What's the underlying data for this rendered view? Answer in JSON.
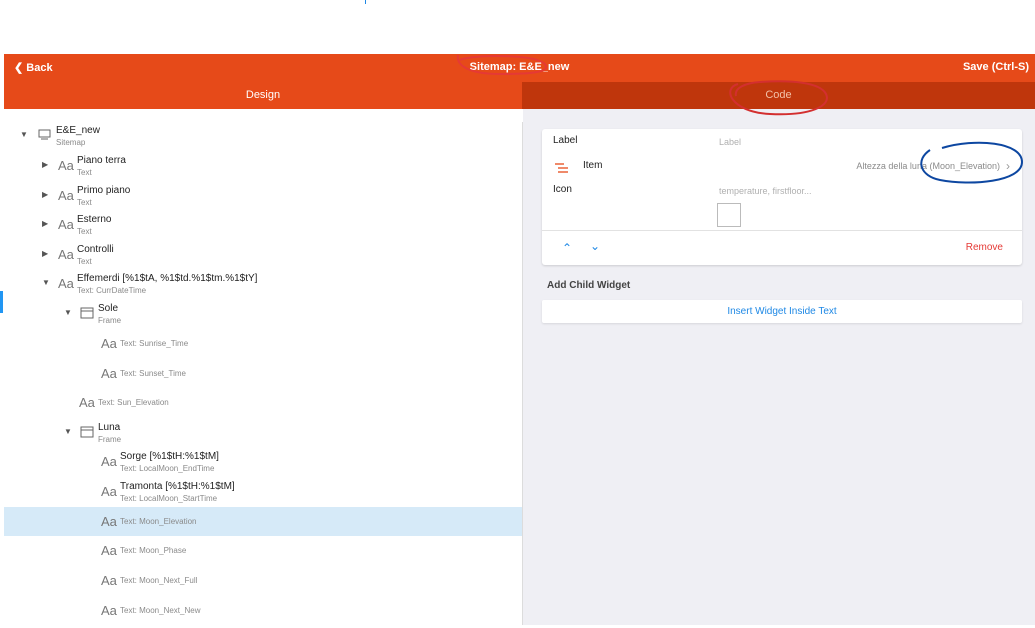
{
  "header": {
    "back_label": "Back",
    "title": "Sitemap: E&E_new",
    "save_label": "Save (Ctrl-S)"
  },
  "tabs": [
    {
      "label": "Design",
      "active": true
    },
    {
      "label": "Code",
      "active": false
    }
  ],
  "tree": {
    "root": {
      "name": "E&E_new",
      "type": "Sitemap"
    },
    "items": [
      {
        "name": "Piano terra",
        "sub": "Text"
      },
      {
        "name": "Primo piano",
        "sub": "Text"
      },
      {
        "name": "Esterno",
        "sub": "Text"
      },
      {
        "name": "Controlli",
        "sub": "Text"
      },
      {
        "name": "Effemerdi [%1$tA, %1$td.%1$tm.%1$tY]",
        "sub": "Text: CurrDateTime"
      },
      {
        "name": "Sole",
        "sub": "Frame"
      },
      {
        "name": "Text: Sunrise_Time"
      },
      {
        "name": "Text: Sunset_Time"
      },
      {
        "name": "Text: Sun_Elevation"
      },
      {
        "name": "Luna",
        "sub": "Frame"
      },
      {
        "name": "Sorge [%1$tH:%1$tM]",
        "sub": "Text: LocalMoon_EndTime"
      },
      {
        "name": "Tramonta [%1$tH:%1$tM]",
        "sub": "Text: LocalMoon_StartTime"
      },
      {
        "name": "Text: Moon_Elevation"
      },
      {
        "name": "Text: Moon_Phase"
      },
      {
        "name": "Text: Moon_Next_Full"
      },
      {
        "name": "Text: Moon_Next_New"
      }
    ]
  },
  "details": {
    "label_caption": "Label",
    "label_placeholder": "Label",
    "item_caption": "Item",
    "item_value": "Altezza della luna (Moon_Elevation)",
    "icon_caption": "Icon",
    "icon_placeholder": "temperature, firstfloor...",
    "remove_label": "Remove"
  },
  "child": {
    "section_title": "Add Child Widget",
    "insert_label": "Insert Widget Inside Text"
  },
  "colors": {
    "accent": "#e64a19",
    "accent_dark": "#bf360c",
    "link": "#1e88e5",
    "danger": "#e53935",
    "selected_row": "#d6eaf8"
  }
}
